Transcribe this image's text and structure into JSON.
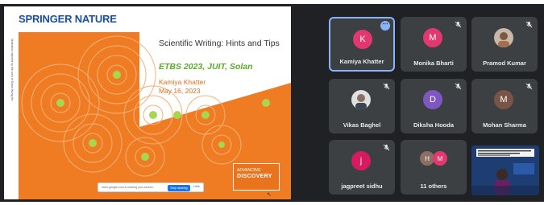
{
  "slide": {
    "brand": "SPRINGER NATURE",
    "side_text": "Illustration inspired by the work of Dawn Wong Ho",
    "title": "Scientific Writing: Hints and Tips",
    "subtitle": "ETBS 2023, JUIT, Solan",
    "author": "Kamiya Khatter",
    "date": "May 16, 2023",
    "badge_line1": "ADVANCING",
    "badge_line2": "DISCOVERY",
    "share_text": "meet.google.com is sharing your screen.",
    "stop_label": "Stop sharing",
    "hide_label": "Hide"
  },
  "colors": {
    "orange": "#ef7c22",
    "brand_blue": "#1a4f9c",
    "subtitle_green": "#5aab2a",
    "tile_bg": "#3c4043",
    "background": "#202124"
  },
  "participants": [
    {
      "name": "Kamiya Khatter",
      "initial": "K",
      "avatar_color": "#e2386f",
      "active": true,
      "icon": "more-dots-icon"
    },
    {
      "name": "Monika Bharti",
      "initial": "M",
      "avatar_color": "#e2386f",
      "icon": "mic-off-icon"
    },
    {
      "name": "Pramod Kumar",
      "initial": "",
      "avatar_color": "#8d6e63",
      "icon": "mic-off-icon",
      "photo": true
    },
    {
      "name": "Vikas Baghel",
      "initial": "",
      "avatar_color": "#9e9e9e",
      "icon": "mic-off-icon",
      "photo": true
    },
    {
      "name": "Diksha Hooda",
      "initial": "D",
      "avatar_color": "#7e57c2",
      "icon": "mic-off-icon"
    },
    {
      "name": "Mohan Sharma",
      "initial": "M",
      "avatar_color": "#795548",
      "icon": "mic-off-icon"
    },
    {
      "name": "jagpreet sidhu",
      "initial": "j",
      "avatar_color": "#d81b60",
      "icon": "mic-off-icon"
    }
  ],
  "others": {
    "label": "11 others",
    "initial_a": "H",
    "color_a": "#8d6e63",
    "initial_b": "M",
    "color_b": "#e2386f"
  }
}
